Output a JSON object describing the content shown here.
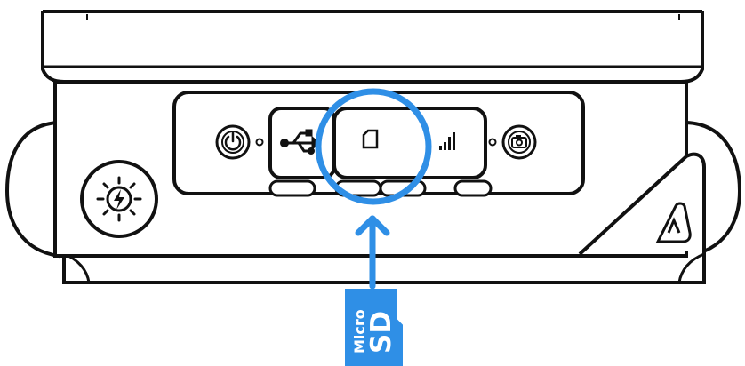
{
  "diagram": {
    "card": {
      "label_top": "Micro",
      "label_bottom": "SD"
    },
    "icons": [
      "power-icon",
      "usb-icon",
      "sd-card-icon",
      "signal-bars-icon",
      "camera-icon",
      "flash-icon",
      "latch-icon"
    ],
    "colors": {
      "accent": "#2f8fe6",
      "outline": "#111111",
      "device_fill": "#ffffff"
    }
  }
}
